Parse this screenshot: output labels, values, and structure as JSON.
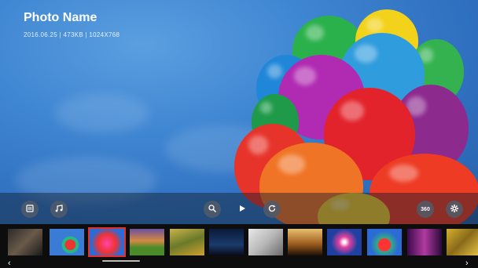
{
  "photo": {
    "name": "Photo Name",
    "meta": "2016.06.25  |  473KB  |  1024X768"
  },
  "controls": {
    "list_icon": "list-icon",
    "music_icon": "music-icon",
    "zoom_icon": "zoom-icon",
    "play_icon": "play-icon",
    "rotate_icon": "rotate-icon",
    "view360_label": "360",
    "settings_icon": "gear-icon"
  },
  "thumbnails": [
    {
      "desc": "phones",
      "selected": false
    },
    {
      "desc": "balloons-blue",
      "selected": false
    },
    {
      "desc": "balloons",
      "selected": true
    },
    {
      "desc": "sunset-field",
      "selected": false
    },
    {
      "desc": "autumn-trees",
      "selected": false
    },
    {
      "desc": "night-city",
      "selected": false
    },
    {
      "desc": "dog",
      "selected": false
    },
    {
      "desc": "horse-rider",
      "selected": false
    },
    {
      "desc": "motion-lights",
      "selected": false
    },
    {
      "desc": "balloons-2",
      "selected": false
    },
    {
      "desc": "purple-forest",
      "selected": false
    },
    {
      "desc": "autumn-leaves",
      "selected": false
    }
  ],
  "colors": {
    "selected_border": "#e0312f",
    "sky": "#3f86d2"
  }
}
